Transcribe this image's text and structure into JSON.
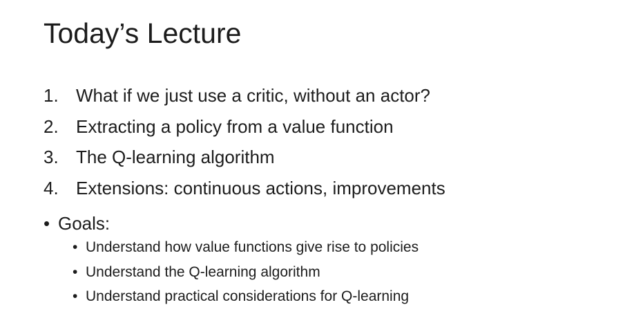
{
  "title": "Today’s Lecture",
  "numbered_items": [
    {
      "number": "1.",
      "text": "What if we just use a critic, without an actor?"
    },
    {
      "number": "2.",
      "text": "Extracting a policy from a value function"
    },
    {
      "number": "3.",
      "text": "The Q-learning algorithm"
    },
    {
      "number": "4.",
      "text": "Extensions: continuous actions, improvements"
    }
  ],
  "goals": {
    "bullet": "•",
    "label": "Goals:",
    "items": [
      "Understand how value functions give rise to policies",
      "Understand the Q-learning algorithm",
      "Understand practical considerations for Q-learning"
    ]
  }
}
